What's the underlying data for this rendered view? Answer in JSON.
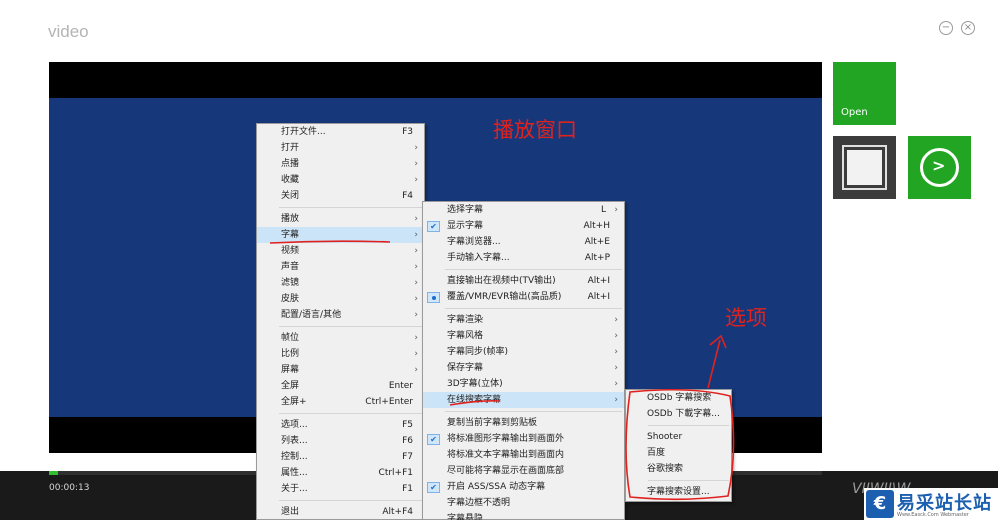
{
  "window": {
    "title": "video",
    "minimize_icon": "minimize-icon",
    "close_icon": "close-icon"
  },
  "overlay_labels": {
    "player_window": "播放窗口",
    "options": "选项"
  },
  "playback": {
    "time": "00:00:13",
    "progress_percent": 0.8
  },
  "tiles": {
    "open_label": "Open",
    "stop_icon": "stop-icon",
    "play_icon": "play-icon"
  },
  "context_menu": {
    "items": [
      {
        "label": "打开文件...",
        "shortcut": "F3"
      },
      {
        "label": "打开",
        "arrow": "›"
      },
      {
        "label": "点播",
        "arrow": "›"
      },
      {
        "label": "收藏",
        "arrow": "›"
      },
      {
        "label": "关闭",
        "shortcut": "F4"
      },
      {
        "label": "播放",
        "arrow": "›"
      },
      {
        "label": "字幕",
        "arrow": "›"
      },
      {
        "label": "视频",
        "arrow": "›"
      },
      {
        "label": "声音",
        "arrow": "›"
      },
      {
        "label": "滤镜",
        "arrow": "›"
      },
      {
        "label": "皮肤",
        "arrow": "›"
      },
      {
        "label": "配置/语言/其他",
        "arrow": "›"
      },
      {
        "label": "帧位",
        "arrow": "›"
      },
      {
        "label": "比例",
        "arrow": "›"
      },
      {
        "label": "屏幕",
        "arrow": "›"
      },
      {
        "label": "全屏",
        "shortcut": "Enter"
      },
      {
        "label": "全屏+",
        "shortcut": "Ctrl+Enter"
      },
      {
        "label": "选项...",
        "shortcut": "F5"
      },
      {
        "label": "列表...",
        "shortcut": "F6"
      },
      {
        "label": "控制...",
        "shortcut": "F7"
      },
      {
        "label": "属性...",
        "shortcut": "Ctrl+F1"
      },
      {
        "label": "关于...",
        "shortcut": "F1"
      },
      {
        "label": "退出",
        "shortcut": "Alt+F4"
      }
    ]
  },
  "subtitle_menu": {
    "items": [
      {
        "label": "选择字幕",
        "shortcut": "L",
        "arrow": "›"
      },
      {
        "label": "显示字幕",
        "shortcut": "Alt+H",
        "check": "✔"
      },
      {
        "label": "字幕浏览器...",
        "shortcut": "Alt+E"
      },
      {
        "label": "手动输入字幕...",
        "shortcut": "Alt+P"
      },
      {
        "label": "直接输出在视频中(TV输出)",
        "shortcut": "Alt+I"
      },
      {
        "label": "覆盖/VMR/EVR输出(高品质)",
        "shortcut": "Alt+I"
      },
      {
        "label": "字幕渲染",
        "arrow": "›"
      },
      {
        "label": "字幕风格",
        "arrow": "›"
      },
      {
        "label": "字幕同步(帧率)",
        "arrow": "›"
      },
      {
        "label": "保存字幕",
        "arrow": "›"
      },
      {
        "label": "3D字幕(立体)",
        "arrow": "›"
      },
      {
        "label": "在线搜索字幕",
        "arrow": "›"
      },
      {
        "label": "复制当前字幕到剪贴板"
      },
      {
        "label": "将标准图形字幕输出到画面外",
        "check": "✔"
      },
      {
        "label": "将标准文本字幕输出到画面内"
      },
      {
        "label": "尽可能将字幕显示在画面底部"
      },
      {
        "label": "开启 ASS/SSA 动态字幕",
        "check": "✔"
      },
      {
        "label": "字幕边框不透明"
      },
      {
        "label": "字幕悬隐"
      }
    ]
  },
  "online_search_menu": {
    "items": [
      {
        "label": "OSDb 字幕搜索"
      },
      {
        "label": "OSDb 下載字幕..."
      },
      {
        "label": "Shooter"
      },
      {
        "label": "百度"
      },
      {
        "label": "谷歌搜索"
      },
      {
        "label": "字幕搜索设置..."
      }
    ]
  },
  "watermark": {
    "partial_text": "VIIWII\\W..",
    "logo_mark": "€",
    "logo_name": "易采站长站",
    "logo_sub": "Www.Easck.Com Webmaster"
  },
  "colors": {
    "accent_green": "#21a523",
    "annotation_red": "#e0221f",
    "video_blue": "#16387a",
    "menu_highlight": "#cce4f7"
  }
}
